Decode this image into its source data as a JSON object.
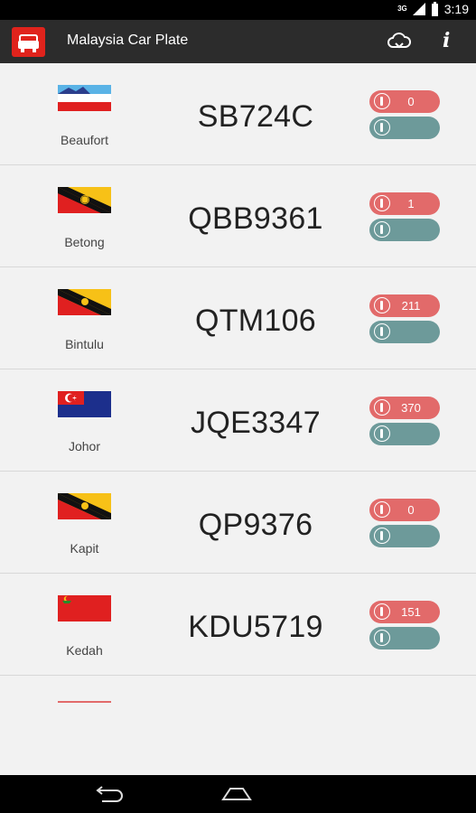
{
  "status": {
    "time": "3:19",
    "network": "3G"
  },
  "app": {
    "title": "Malaysia Car Plate"
  },
  "rows": [
    {
      "state": "Beaufort",
      "plate": "SB724C",
      "count": "0",
      "flag": "sabah-flag"
    },
    {
      "state": "Betong",
      "plate": "QBB9361",
      "count": "1",
      "flag": "sarawak-flag"
    },
    {
      "state": "Bintulu",
      "plate": "QTM106",
      "count": "211",
      "flag": "sarawak-flag"
    },
    {
      "state": "Johor",
      "plate": "JQE3347",
      "count": "370",
      "flag": "johor-flag"
    },
    {
      "state": "Kapit",
      "plate": "QP9376",
      "count": "0",
      "flag": "sarawak-flag"
    },
    {
      "state": "Kedah",
      "plate": "KDU5719",
      "count": "151",
      "flag": "kedah-flag"
    }
  ],
  "colors": {
    "appBar": "#2c2c2c",
    "accentRed": "#e0231c",
    "pillRed": "#e26a6a",
    "pillTeal": "#6d9a9a"
  }
}
